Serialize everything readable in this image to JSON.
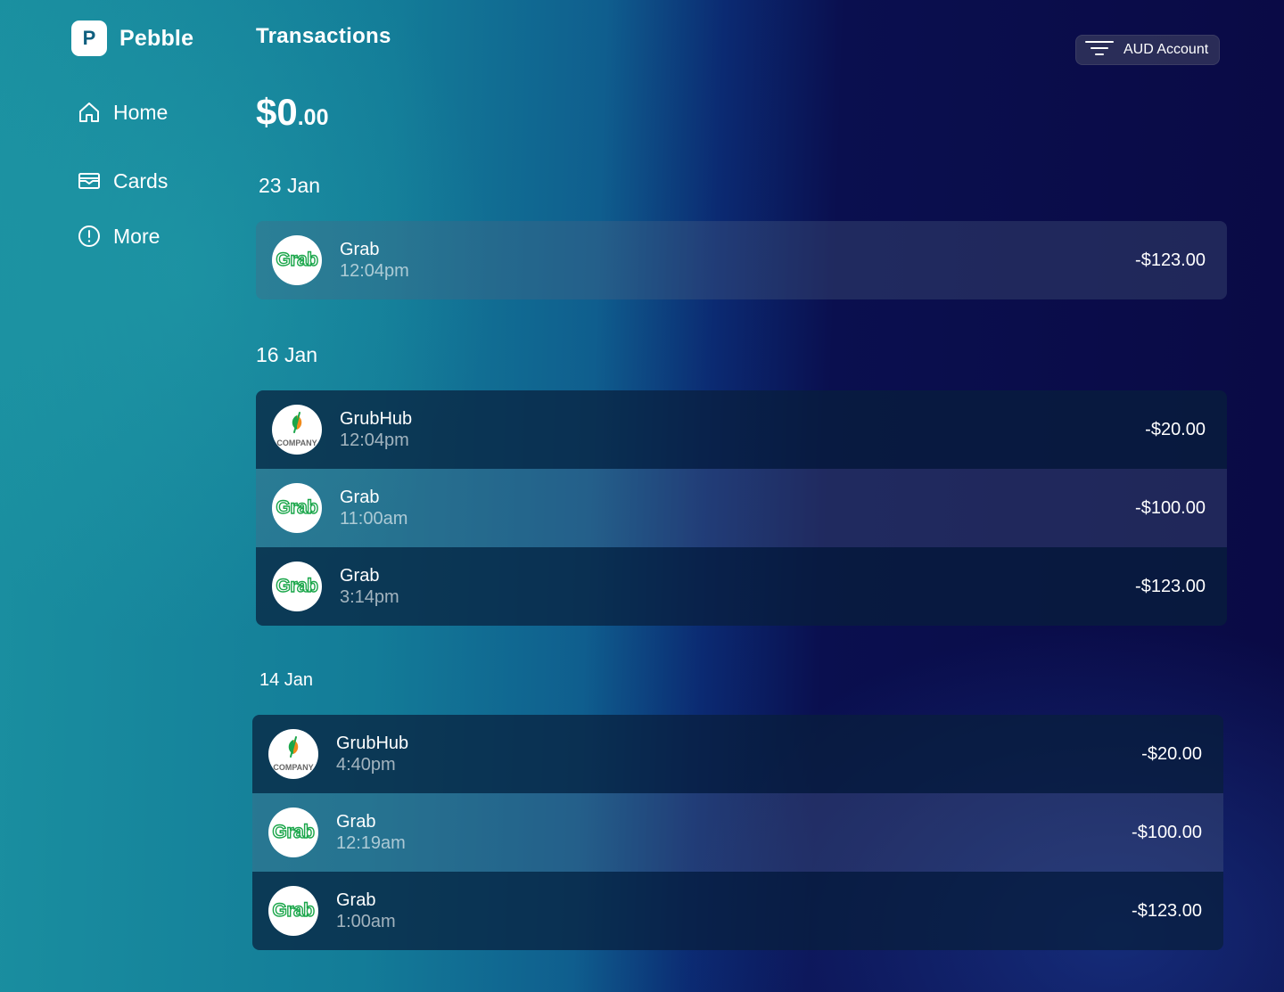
{
  "app": {
    "name": "Pebble",
    "logo_letter": "P"
  },
  "sidebar": {
    "items": [
      {
        "label": "Home",
        "icon": "home-icon"
      },
      {
        "label": "Cards",
        "icon": "card-icon"
      },
      {
        "label": "More",
        "icon": "info-icon"
      }
    ]
  },
  "header": {
    "title": "Transactions",
    "account_label": "AUD Account",
    "account_icon": "filter-icon"
  },
  "balance": {
    "main": "$0",
    "cents": ".00"
  },
  "groups": [
    {
      "date": "23 Jan",
      "transactions": [
        {
          "merchant": "Grab",
          "time": "12:04pm",
          "amount": "-$123.00",
          "logo": "grab-logo"
        }
      ]
    },
    {
      "date": "16 Jan",
      "transactions": [
        {
          "merchant": "GrubHub",
          "time": "12:04pm",
          "amount": "-$20.00",
          "logo": "company-logo",
          "logo_text": "COMPANY"
        },
        {
          "merchant": "Grab",
          "time": "11:00am",
          "amount": "-$100.00",
          "logo": "grab-logo"
        },
        {
          "merchant": "Grab",
          "time": "3:14pm",
          "amount": "-$123.00",
          "logo": "grab-logo"
        }
      ]
    },
    {
      "date": "14 Jan",
      "transactions": [
        {
          "merchant": "GrubHub",
          "time": "4:40pm",
          "amount": "-$20.00",
          "logo": "company-logo",
          "logo_text": "COMPANY"
        },
        {
          "merchant": "Grab",
          "time": "12:19am",
          "amount": "-$100.00",
          "logo": "grab-logo"
        },
        {
          "merchant": "Grab",
          "time": "1:00am",
          "amount": "-$123.00",
          "logo": "grab-logo"
        }
      ]
    }
  ],
  "logos": {
    "grab_text": "Grab",
    "company_text": "COMPANY"
  },
  "colors": {
    "grab_green": "#1aa64a",
    "company_orange": "#f08a1c",
    "brand_dark": "#0f5f7f"
  }
}
